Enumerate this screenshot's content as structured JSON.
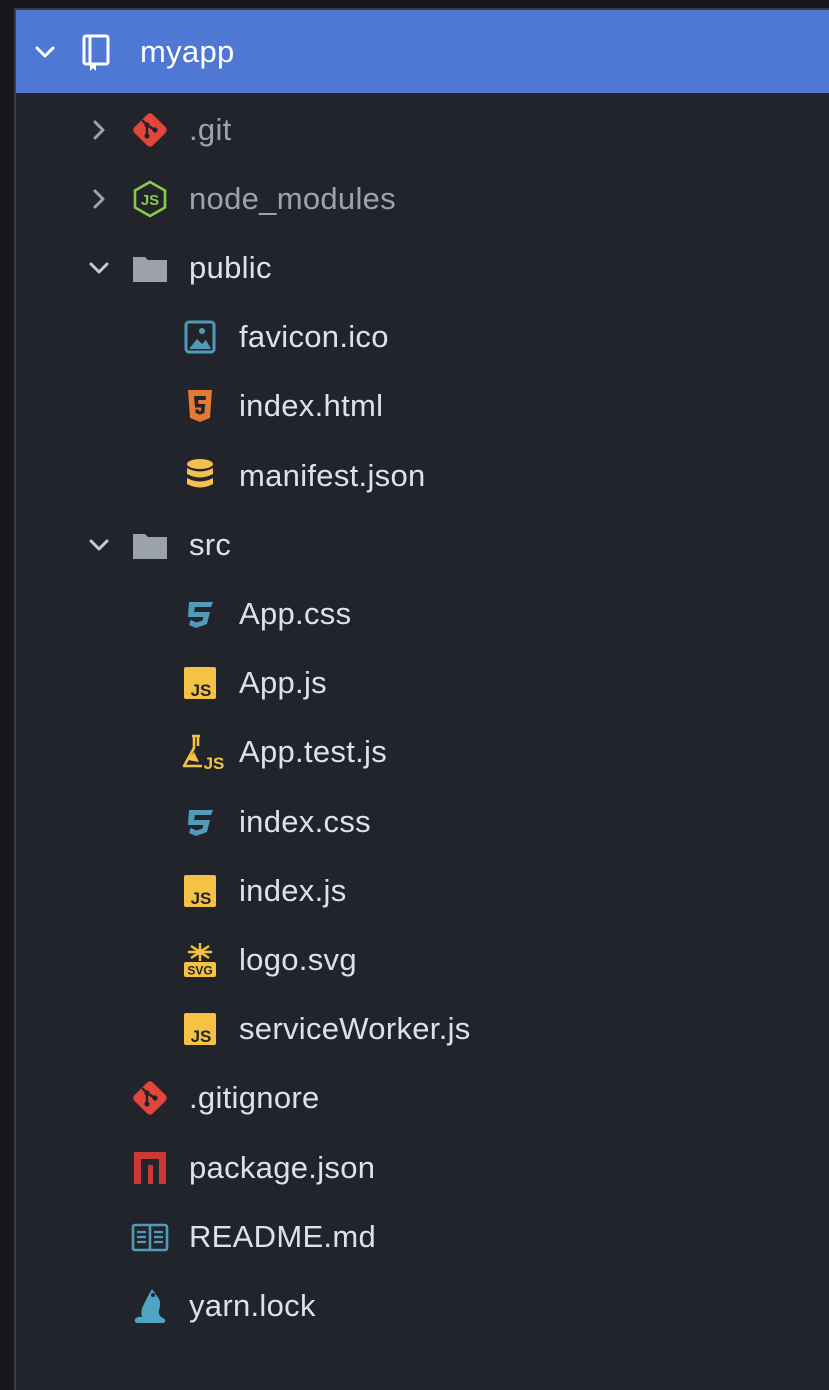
{
  "tree": {
    "root": {
      "label": "myapp",
      "icon": "repo-icon",
      "expanded": true
    },
    "items": [
      {
        "label": ".git",
        "icon": "git-icon",
        "type": "folder",
        "expanded": false,
        "depth": 1,
        "dimmed": true
      },
      {
        "label": "node_modules",
        "icon": "nodejs-icon",
        "type": "folder",
        "expanded": false,
        "depth": 1,
        "dimmed": true
      },
      {
        "label": "public",
        "icon": "folder-icon",
        "type": "folder",
        "expanded": true,
        "depth": 1
      },
      {
        "label": "favicon.ico",
        "icon": "image-icon",
        "type": "file",
        "depth": 2
      },
      {
        "label": "index.html",
        "icon": "html5-icon",
        "type": "file",
        "depth": 2
      },
      {
        "label": "manifest.json",
        "icon": "database-icon",
        "type": "file",
        "depth": 2
      },
      {
        "label": "src",
        "icon": "folder-icon",
        "type": "folder",
        "expanded": true,
        "depth": 1
      },
      {
        "label": "App.css",
        "icon": "css3-icon",
        "type": "file",
        "depth": 2
      },
      {
        "label": "App.js",
        "icon": "js-icon",
        "type": "file",
        "depth": 2
      },
      {
        "label": "App.test.js",
        "icon": "test-js-icon",
        "type": "file",
        "depth": 2
      },
      {
        "label": "index.css",
        "icon": "css3-icon",
        "type": "file",
        "depth": 2
      },
      {
        "label": "index.js",
        "icon": "js-icon",
        "type": "file",
        "depth": 2
      },
      {
        "label": "logo.svg",
        "icon": "svg-icon",
        "type": "file",
        "depth": 2
      },
      {
        "label": "serviceWorker.js",
        "icon": "js-icon",
        "type": "file",
        "depth": 2
      },
      {
        "label": ".gitignore",
        "icon": "git-icon",
        "type": "file",
        "depth": 1
      },
      {
        "label": "package.json",
        "icon": "npm-icon",
        "type": "file",
        "depth": 1
      },
      {
        "label": "README.md",
        "icon": "readme-icon",
        "type": "file",
        "depth": 1
      },
      {
        "label": "yarn.lock",
        "icon": "yarn-icon",
        "type": "file",
        "depth": 1
      }
    ]
  },
  "colors": {
    "panel_bg": "#21252b",
    "selection": "#4f78d4",
    "text": "#dde2ea",
    "text_dim": "#9aa3b0",
    "folder": "#9ba2ab",
    "git": "#e2453a",
    "node": "#8cc84b",
    "html": "#e37933",
    "json": "#f4bf4f",
    "css": "#519aba",
    "js": "#f5c244",
    "image": "#519aba",
    "npm": "#cb3837",
    "readme": "#519aba",
    "yarn": "#4fa3c5"
  }
}
